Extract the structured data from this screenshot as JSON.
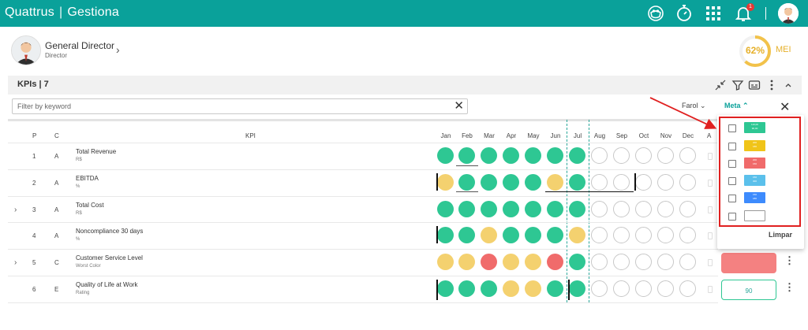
{
  "app": {
    "brand": "Quattrus",
    "product": "Gestiona",
    "separator": "|"
  },
  "topbar": {
    "icons": [
      "face-mask-icon",
      "stopwatch-icon",
      "apps-grid-icon",
      "bell-icon"
    ],
    "notification_count": "1"
  },
  "profile": {
    "name": "General Director",
    "role": "Director"
  },
  "mei": {
    "percent": "62%",
    "value": 0.62,
    "label": "MEI",
    "color": "#e6b02a"
  },
  "kpis": {
    "title": "KPIs | 7",
    "filter_placeholder": "Filter by keyword",
    "segments": {
      "farol": "Farol",
      "meta": "Meta"
    }
  },
  "columns": {
    "p": "P",
    "c": "C",
    "kpi": "KPI",
    "a": "A"
  },
  "months": [
    "Jan",
    "Feb",
    "Mar",
    "Apr",
    "May",
    "Jun",
    "Jul",
    "Aug",
    "Sep",
    "Oct",
    "Nov",
    "Dec"
  ],
  "rows": [
    {
      "p": "1",
      "c": "A",
      "name": "Total Revenue",
      "unit": "R$",
      "expandable": false,
      "status": [
        "green",
        "green",
        "green",
        "green",
        "green",
        "green",
        "green",
        "empty",
        "empty",
        "empty",
        "empty",
        "empty"
      ]
    },
    {
      "p": "2",
      "c": "A",
      "name": "EBITDA",
      "unit": "%",
      "expandable": false,
      "status": [
        "yellow",
        "green",
        "green",
        "green",
        "green",
        "yellow",
        "green",
        "empty",
        "empty",
        "empty",
        "empty",
        "empty"
      ]
    },
    {
      "p": "3",
      "c": "A",
      "name": "Total Cost",
      "unit": "R$",
      "expandable": true,
      "status": [
        "green",
        "green",
        "green",
        "green",
        "green",
        "green",
        "green",
        "empty",
        "empty",
        "empty",
        "empty",
        "empty"
      ]
    },
    {
      "p": "4",
      "c": "A",
      "name": "Noncompliance 30 days",
      "unit": "%",
      "expandable": false,
      "status": [
        "green",
        "green",
        "yellow",
        "green",
        "green",
        "green",
        "yellow",
        "empty",
        "empty",
        "empty",
        "empty",
        "empty"
      ]
    },
    {
      "p": "5",
      "c": "C",
      "name": "Customer Service Level",
      "unit": "Worst Color",
      "expandable": true,
      "status": [
        "yellow",
        "yellow",
        "red",
        "yellow",
        "yellow",
        "red",
        "green",
        "empty",
        "empty",
        "empty",
        "empty",
        "empty"
      ],
      "target": {
        "style": "red",
        "value": ""
      }
    },
    {
      "p": "6",
      "c": "E",
      "name": "Quality of Life at Work",
      "unit": "Rating",
      "expandable": false,
      "status": [
        "green",
        "green",
        "green",
        "yellow",
        "yellow",
        "green",
        "green",
        "empty",
        "empty",
        "empty",
        "empty",
        "empty"
      ],
      "target": {
        "style": "outline",
        "value": "90"
      }
    }
  ],
  "meta_popover": {
    "options": [
      {
        "color": "#2ec793",
        "lines": [
          "110,00",
          "90,00"
        ]
      },
      {
        "color": "#f0c419",
        "lines": [
          "200",
          "180"
        ]
      },
      {
        "color": "#f06b6b",
        "lines": [
          "200",
          "150"
        ]
      },
      {
        "color": "#5bc0eb",
        "lines": [
          "150",
          "300"
        ]
      },
      {
        "color": "#3d8bfd",
        "lines": [
          "150",
          "180"
        ]
      },
      {
        "color": "#ffffff",
        "lines": []
      }
    ],
    "clear_label": "Limpar"
  },
  "colors": {
    "primary": "#0aa19a",
    "green": "#2ec793",
    "yellow": "#f4d16f",
    "red": "#f06b6b",
    "highlight": "#e02020"
  }
}
